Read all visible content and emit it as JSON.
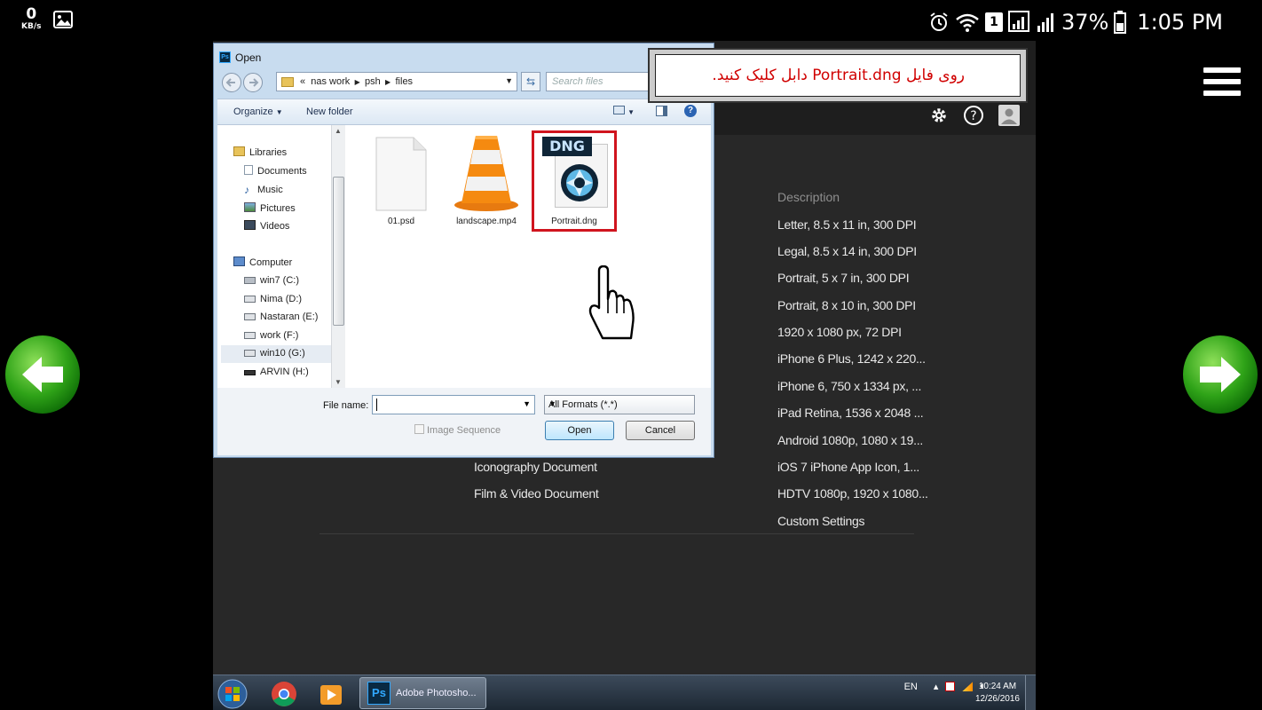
{
  "status_bar": {
    "speed_value": "0",
    "speed_unit": "KB/s",
    "sim_slot": "1",
    "battery": "37%",
    "time": "1:05 PM",
    "icons": [
      "image-icon",
      "alarm-icon",
      "wifi-icon",
      "sim-badge",
      "signal-icon",
      "battery-icon"
    ]
  },
  "callout": {
    "text": "روی فایل Portrait.dng دابل کلیک کنید."
  },
  "photoshop": {
    "description_header": "Description",
    "descriptions": [
      "Letter, 8.5 x 11 in, 300 DPI",
      "Legal, 8.5 x 14 in, 300 DPI",
      "Portrait, 5 x 7 in, 300 DPI",
      "Portrait, 8 x 10 in, 300 DPI",
      "1920 x 1080 px, 72 DPI",
      "iPhone 6 Plus, 1242 x 220...",
      "iPhone 6, 750 x 1334 px, ...",
      "iPad Retina, 1536 x 2048 ...",
      "Android 1080p, 1080 x 19...",
      "iOS 7 iPhone App Icon, 1...",
      "HDTV 1080p, 1920 x 1080...",
      "Custom Settings"
    ],
    "doc_types": [
      "Iconography Document",
      "Film & Video Document"
    ]
  },
  "dialog": {
    "title": "Open",
    "breadcrumb": [
      "«",
      "nas work",
      "psh",
      "files"
    ],
    "search_placeholder": "Search files",
    "organize": "Organize",
    "new_folder": "New folder",
    "nav": [
      {
        "label": "Libraries",
        "icon": "libraries-icon"
      },
      {
        "label": "Documents",
        "icon": "documents-icon"
      },
      {
        "label": "Music",
        "icon": "music-icon"
      },
      {
        "label": "Pictures",
        "icon": "pictures-icon"
      },
      {
        "label": "Videos",
        "icon": "videos-icon"
      },
      {
        "label": "Computer",
        "icon": "computer-icon"
      },
      {
        "label": "win7 (C:)",
        "icon": "drive-icon"
      },
      {
        "label": "Nima (D:)",
        "icon": "drive-icon"
      },
      {
        "label": "Nastaran (E:)",
        "icon": "drive-icon"
      },
      {
        "label": "work (F:)",
        "icon": "drive-icon"
      },
      {
        "label": "win10 (G:)",
        "icon": "drive-icon"
      },
      {
        "label": "ARVIN (H:)",
        "icon": "drive-icon"
      }
    ],
    "files": [
      {
        "name": "01.psd",
        "icon": "blank-file-icon"
      },
      {
        "name": "landscape.mp4",
        "icon": "vlc-cone-icon"
      },
      {
        "name": "Portrait.dng",
        "icon": "dng-file-icon",
        "badge": "DNG"
      }
    ],
    "file_name_label": "File name:",
    "file_name_value": "",
    "format": "All Formats (*.*)",
    "image_sequence": "Image Sequence",
    "open": "Open",
    "cancel": "Cancel"
  },
  "taskbar": {
    "ps_label": "Adobe Photosho...",
    "lang": "EN",
    "clock_time": "10:24 AM",
    "clock_date": "12/26/2016"
  }
}
